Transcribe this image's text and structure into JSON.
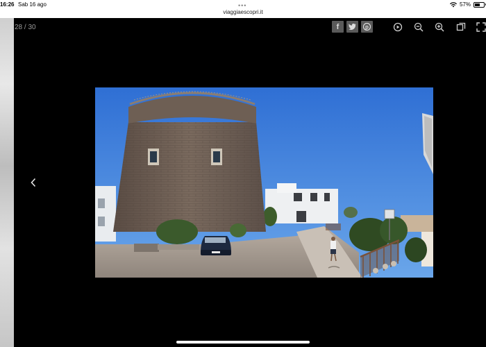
{
  "status_bar": {
    "time": "16:26",
    "date": "Sab 16 ago",
    "battery_percent": "57%",
    "battery_level": 0.57
  },
  "browser": {
    "url": "viaggiaescopri.it"
  },
  "gallery": {
    "counter": "28 / 30",
    "share_buttons": [
      {
        "name": "facebook-icon",
        "glyph": "f"
      },
      {
        "name": "twitter-icon",
        "glyph": "t"
      },
      {
        "name": "pinterest-icon",
        "glyph": "P"
      }
    ],
    "toolbar_icons": [
      "play-icon",
      "zoom-out-icon",
      "zoom-in-icon",
      "fullscreen-toggle-icon",
      "expand-icon"
    ],
    "nav": {
      "previous": "chevron-left-icon"
    },
    "image_subject": "stone-tower-photo"
  },
  "colors": {
    "background": "#000000",
    "share_button_bg": "#5a5a5a",
    "toolbar_icon": "#cfcfcf",
    "counter_text": "#9a9a9a"
  }
}
